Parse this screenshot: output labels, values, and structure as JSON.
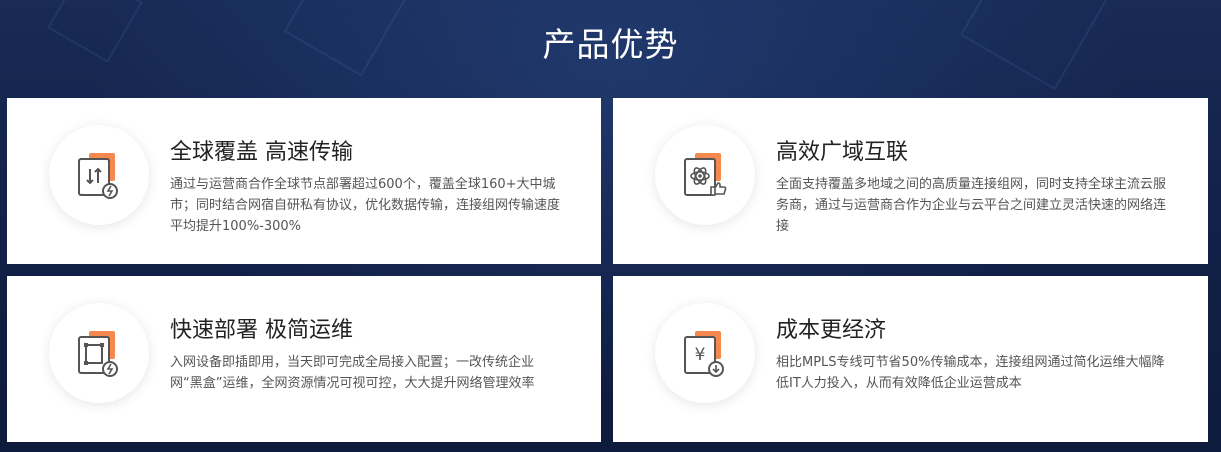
{
  "page": {
    "title": "产品优势"
  },
  "cards": [
    {
      "title": "全球覆盖 高速传输",
      "desc": "通过与运营商合作全球节点部署超过600个，覆盖全球160+大中城市；同时结合网宿自研私有协议，优化数据传输，连接组网传输速度平均提升100%-300%",
      "icon": "global-transfer-icon"
    },
    {
      "title": "高效广域互联",
      "desc": "全面支持覆盖多地域之间的高质量连接组网，同时支持全球主流云服务商，通过与运营商合作为企业与云平台之间建立灵活快速的网络连接",
      "icon": "interconnect-icon"
    },
    {
      "title": "快速部署 极简运维",
      "desc": "入网设备即插即用，当天即可完成全局接入配置；一改传统企业网“黑盒”运维，全网资源情况可视可控，大大提升网络管理效率",
      "icon": "deploy-icon"
    },
    {
      "title": "成本更经济",
      "desc": "相比MPLS专线可节省50%传输成本，连接组网通过简化运维大幅降低IT人力投入，从而有效降低企业运营成本",
      "icon": "cost-icon"
    }
  ],
  "colors": {
    "background": "#14244a",
    "accent": "#f47b3b",
    "icon_stroke": "#555555"
  }
}
